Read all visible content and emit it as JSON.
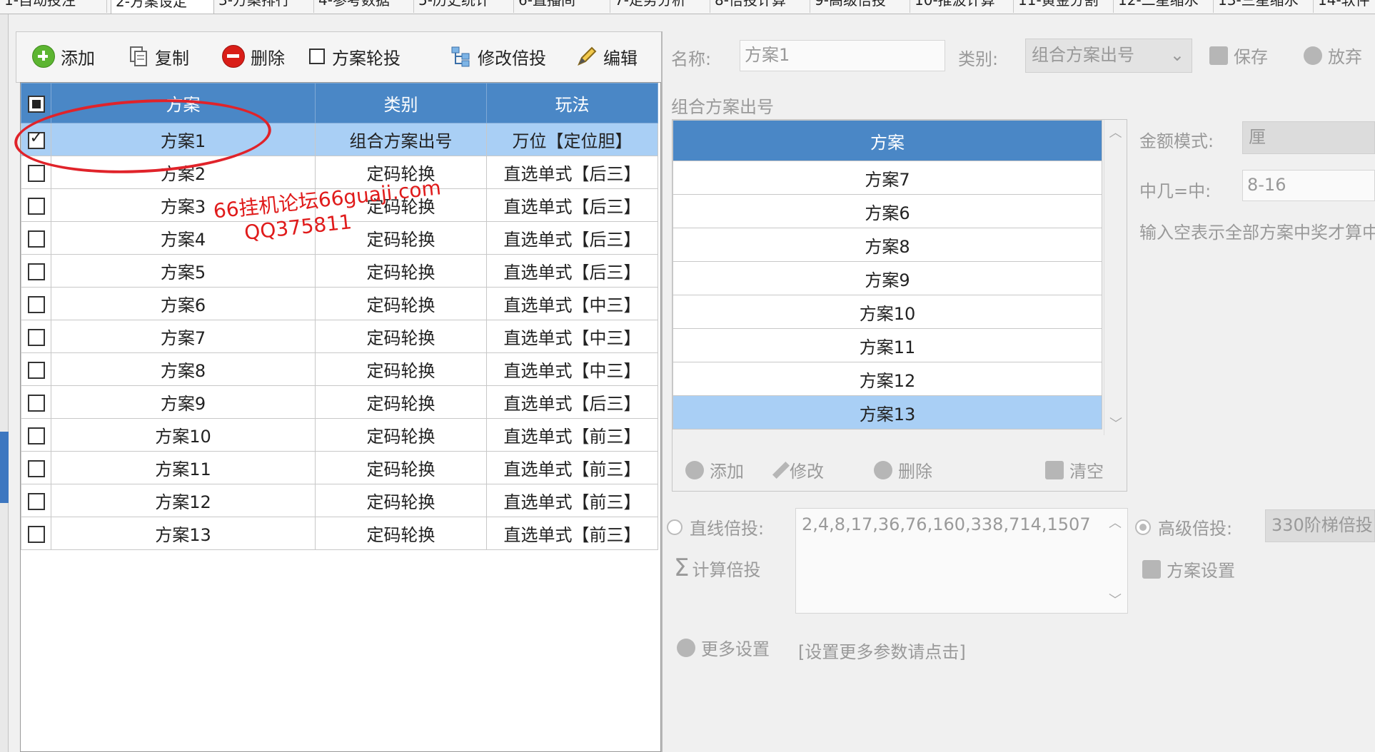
{
  "tabs": [
    "1-自动投注",
    "2-方案设定",
    "3-方案排行",
    "4-参考数据",
    "5-历史统计",
    "6-直播间",
    "7-走势分析",
    "8-倍投计算",
    "9-高级倍投",
    "10-推波计算",
    "11-黄金分割",
    "12-二星缩水",
    "13-三星缩水",
    "14-软件"
  ],
  "toolbar": {
    "add": "添加",
    "copy": "复制",
    "delete": "删除",
    "rotate": "方案轮投",
    "modify": "修改倍投",
    "edit": "编辑"
  },
  "grid": {
    "headers": [
      "方案",
      "类别",
      "玩法"
    ],
    "rows": [
      {
        "name": "方案1",
        "type": "组合方案出号",
        "play": "万位【定位胆】",
        "checked": true
      },
      {
        "name": "方案2",
        "type": "定码轮换",
        "play": "直选单式【后三】",
        "checked": false
      },
      {
        "name": "方案3",
        "type": "定码轮换",
        "play": "直选单式【后三】",
        "checked": false
      },
      {
        "name": "方案4",
        "type": "定码轮换",
        "play": "直选单式【后三】",
        "checked": false
      },
      {
        "name": "方案5",
        "type": "定码轮换",
        "play": "直选单式【后三】",
        "checked": false
      },
      {
        "name": "方案6",
        "type": "定码轮换",
        "play": "直选单式【中三】",
        "checked": false
      },
      {
        "name": "方案7",
        "type": "定码轮换",
        "play": "直选单式【中三】",
        "checked": false
      },
      {
        "name": "方案8",
        "type": "定码轮换",
        "play": "直选单式【中三】",
        "checked": false
      },
      {
        "name": "方案9",
        "type": "定码轮换",
        "play": "直选单式【后三】",
        "checked": false
      },
      {
        "name": "方案10",
        "type": "定码轮换",
        "play": "直选单式【前三】",
        "checked": false
      },
      {
        "name": "方案11",
        "type": "定码轮换",
        "play": "直选单式【前三】",
        "checked": false
      },
      {
        "name": "方案12",
        "type": "定码轮换",
        "play": "直选单式【前三】",
        "checked": false
      },
      {
        "name": "方案13",
        "type": "定码轮换",
        "play": "直选单式【前三】",
        "checked": false
      }
    ]
  },
  "watermark": {
    "line1": "66挂机论坛66guaji.com",
    "line2": "QQ375811"
  },
  "right": {
    "name_label": "名称:",
    "name_value": "方案1",
    "type_label": "类别:",
    "type_value": "组合方案出号",
    "save": "保存",
    "discard": "放弃",
    "group_title": "组合方案出号",
    "list_header": "方案",
    "list_items": [
      "方案7",
      "方案6",
      "方案8",
      "方案9",
      "方案10",
      "方案11",
      "方案12",
      "方案13"
    ],
    "list_selected_index": 7,
    "inner_add": "添加",
    "inner_modify": "修改",
    "inner_delete": "删除",
    "inner_clear": "清空",
    "amount_label": "金额模式:",
    "amount_value": "厘",
    "hit_label": "中几=中:",
    "hit_value": "8-16",
    "hint": "输入空表示全部方案中奖才算中",
    "linear_label": "直线倍投:",
    "linear_seq": "2,4,8,17,36,76,160,338,714,1507",
    "calc": "计算倍投",
    "advanced_label": "高级倍投:",
    "advanced_value": "330阶梯倍投",
    "scheme_settings": "方案设置",
    "more": "更多设置",
    "more_hint": "[设置更多参数请点击]"
  }
}
